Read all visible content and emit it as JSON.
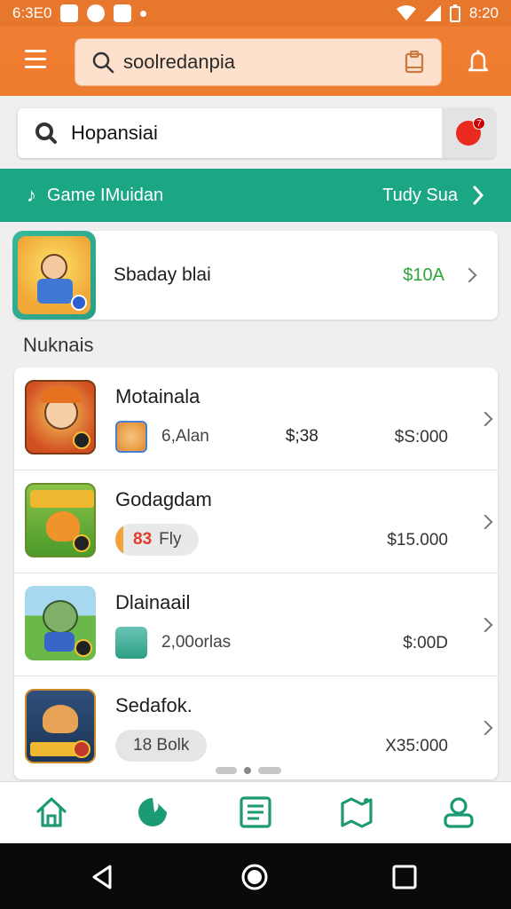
{
  "status_bar": {
    "left_text": "6:3E0",
    "right_time": "8:20",
    "icons": [
      "nfc-icon",
      "notification-icon",
      "message-icon",
      "dot-icon",
      "wifi-icon",
      "signal-icon",
      "battery-icon"
    ]
  },
  "app_bar": {
    "search_text": "soolredanpia",
    "icons": [
      "menu-icon",
      "search-icon",
      "clipboard-icon",
      "bell-icon"
    ]
  },
  "search": {
    "query": "Hopansiai",
    "badge": "7"
  },
  "banner": {
    "left_label": "Game IMuidan",
    "right_label": "Tudy Sua"
  },
  "featured": {
    "title": "Sbaday blai",
    "price": "$10A"
  },
  "section": {
    "title": "Nuknais"
  },
  "list": [
    {
      "name": "Motainala",
      "meta": "6,Alan",
      "meta2": "$;38",
      "price": "$S:000",
      "meta_type": "mini"
    },
    {
      "name": "Godagdam",
      "meta_hl": "83",
      "meta": "Fly",
      "price": "$15.000",
      "meta_type": "pill-orange"
    },
    {
      "name": "Dlainaail",
      "meta": "2,00orlas",
      "price": "$:00D",
      "meta_type": "mini"
    },
    {
      "name": "Sedafok.",
      "meta": "18 Bolk",
      "price": "X35:000",
      "meta_type": "pill"
    }
  ],
  "bottom_nav": [
    "home-icon",
    "discover-icon",
    "list-icon",
    "map-icon",
    "profile-icon"
  ],
  "colors": {
    "accent_orange": "#ee7c2f",
    "accent_green": "#1ba784",
    "price_green": "#2aa63a"
  }
}
